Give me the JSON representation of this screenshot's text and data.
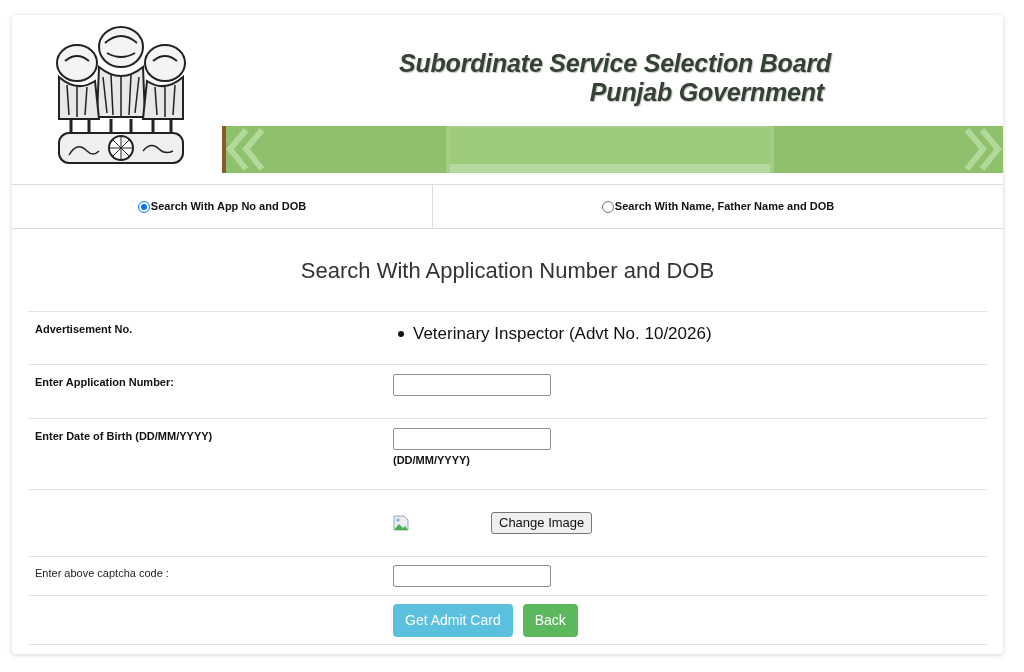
{
  "header": {
    "title": "Subordinate Service Selection Board",
    "subtitle": "Punjab Government"
  },
  "search_modes": [
    {
      "label": "Search With App No and DOB",
      "selected": true
    },
    {
      "label": "Search With Name, Father Name and DOB",
      "selected": false
    }
  ],
  "form": {
    "heading": "Search With Application Number and DOB",
    "rows": [
      {
        "kind": "list",
        "label": "Advertisement No.",
        "items": [
          "Veterinary Inspector (Advt No. 10/2026)"
        ]
      },
      {
        "kind": "input",
        "label": "Enter Application Number:"
      },
      {
        "kind": "input",
        "label": "Enter Date of Birth (DD/MM/YYYY)",
        "hint": "(DD/MM/YYYY)"
      },
      {
        "kind": "captcha",
        "button": "Change Image"
      },
      {
        "kind": "captcha_input",
        "label": "Enter above captcha code :"
      },
      {
        "kind": "actions",
        "buttons": [
          {
            "label": "Get Admit Card",
            "color": "#5bc0de"
          },
          {
            "label": "Back",
            "color": "#5cb85c"
          }
        ]
      }
    ]
  }
}
